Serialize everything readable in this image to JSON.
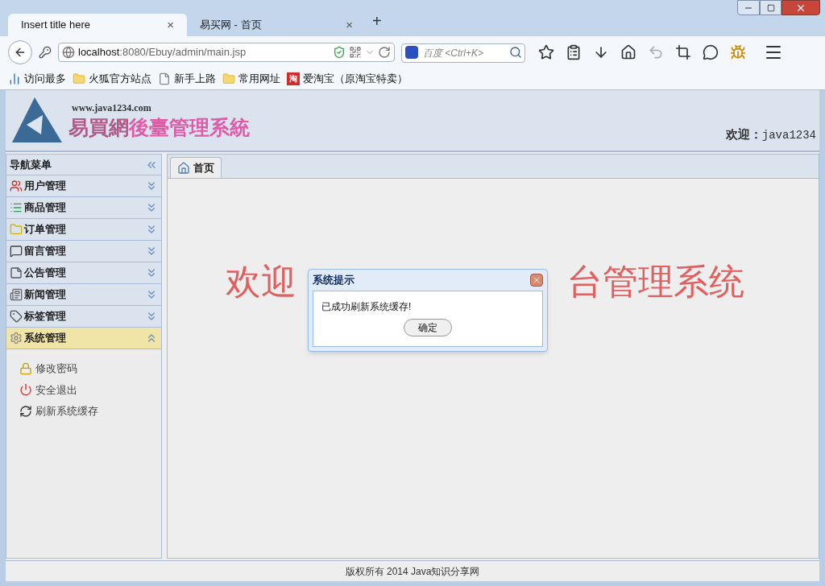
{
  "browser": {
    "tabs": [
      {
        "title": "Insert title here",
        "selected": true,
        "close": "×"
      },
      {
        "title": "易买网 - 首页",
        "selected": false,
        "close": "×"
      }
    ],
    "new_tab": "+",
    "url": {
      "host": "localhost",
      "path": ":8080/Ebuy/admin/main.jsp"
    },
    "search": {
      "placeholder": "百度 <Ctrl+K>"
    },
    "bookmarks": [
      {
        "label": "访问最多",
        "kind": "smart"
      },
      {
        "label": "火狐官方站点",
        "kind": "folder"
      },
      {
        "label": "新手上路",
        "kind": "page"
      },
      {
        "label": "常用网址",
        "kind": "folder"
      },
      {
        "label": "爱淘宝（原淘宝特卖）",
        "kind": "badge",
        "badge": "淘"
      }
    ]
  },
  "header": {
    "site_url": "www.java1234.com",
    "logo_title_left": "易買網",
    "logo_title_right": "後臺管理系統",
    "welcome_label": "欢迎：",
    "username": "java1234"
  },
  "nav": {
    "title": "导航菜单",
    "sections": [
      {
        "label": "用户管理",
        "expanded": false
      },
      {
        "label": "商品管理",
        "expanded": false
      },
      {
        "label": "订单管理",
        "expanded": false
      },
      {
        "label": "留言管理",
        "expanded": false
      },
      {
        "label": "公告管理",
        "expanded": false
      },
      {
        "label": "新闻管理",
        "expanded": false
      },
      {
        "label": "标签管理",
        "expanded": false
      },
      {
        "label": "系统管理",
        "expanded": true,
        "items": [
          {
            "label": "修改密码"
          },
          {
            "label": "安全退出"
          },
          {
            "label": "刷新系统缓存"
          }
        ]
      }
    ]
  },
  "tabs": [
    {
      "label": "首页",
      "selected": true
    }
  ],
  "welcome_banner": {
    "left": "欢迎",
    "right": "台管理系统"
  },
  "dialog": {
    "title": "系统提示",
    "message": "已成功刷新系统缓存!",
    "button": "确定"
  },
  "footer": "版权所有 2014 Java知识分享网"
}
